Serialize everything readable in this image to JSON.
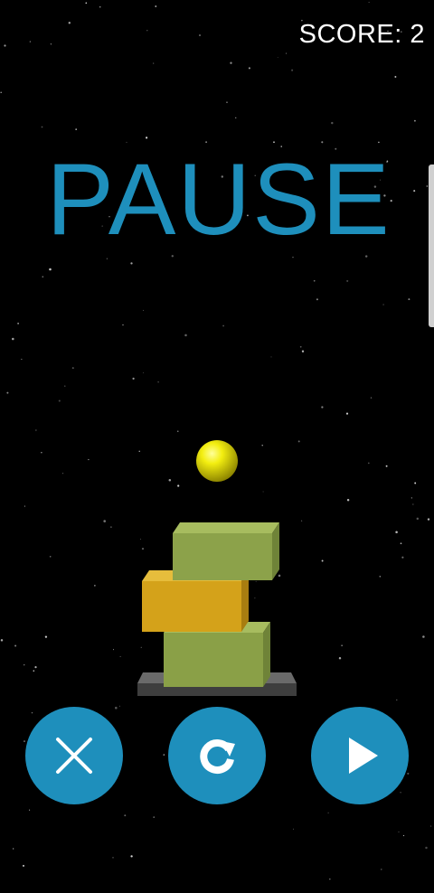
{
  "hud": {
    "score_label": "SCORE: 2"
  },
  "pause_overlay": {
    "title": "PAUSE"
  },
  "controls": {
    "close_icon": "close-icon",
    "restart_icon": "restart-icon",
    "play_icon": "play-icon"
  },
  "colors": {
    "accent": "#1e8fbc",
    "background": "#000000",
    "ball": "#e6e000",
    "block_green": "#8fa34c",
    "block_orange": "#d9a61c",
    "base": "#4a4a4a"
  }
}
